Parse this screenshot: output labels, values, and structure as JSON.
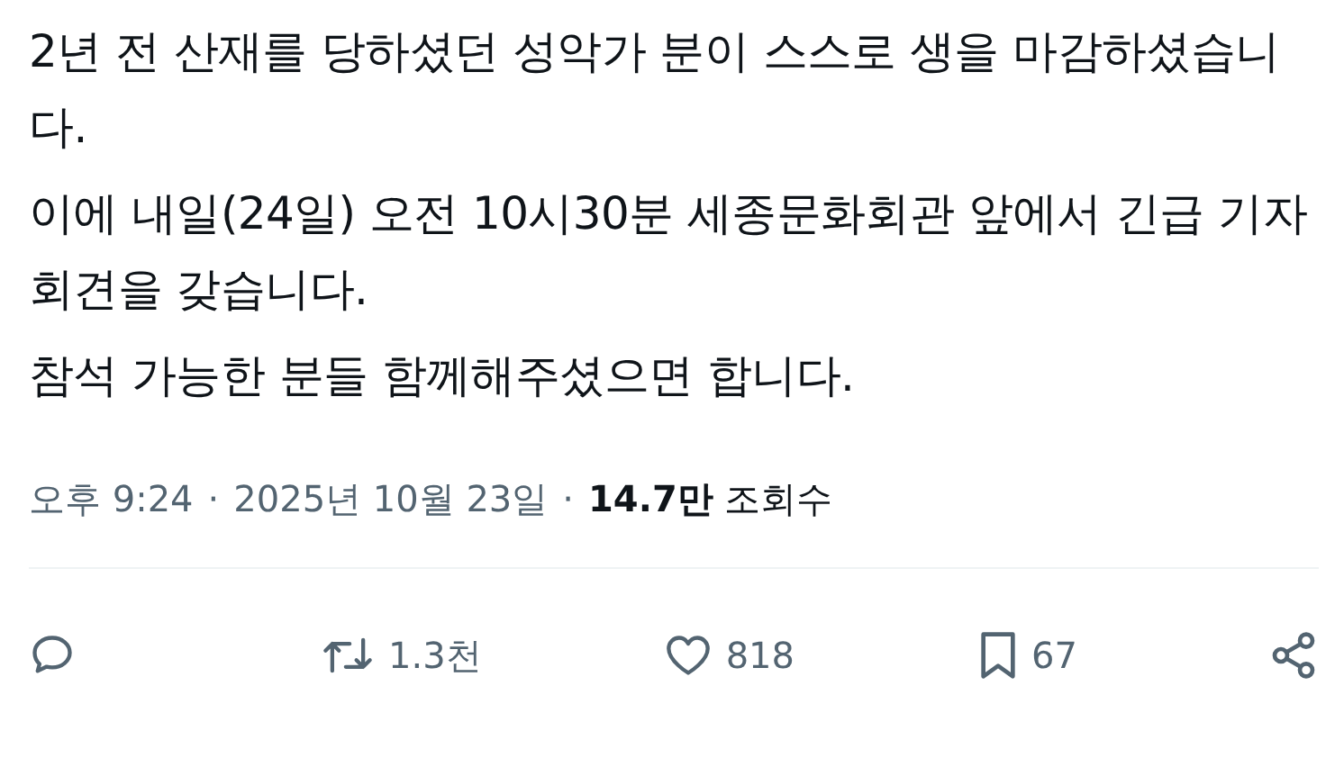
{
  "post": {
    "paragraphs": [
      "2년 전 산재를 당하셨던 성악가 분이 스스로 생을 마감하셨습니다.",
      "이에 내일(24일) 오전 10시30분 세종문화회관 앞에서 긴급 기자회견을 갖습니다.",
      "참석 가능한 분들 함께해주셨으면 합니다."
    ],
    "meta": {
      "time": "오후 9:24",
      "separator_1": "·",
      "date": "2025년 10월 23일",
      "separator_2": "·",
      "views_count": "14.7만",
      "views_label": "조회수"
    },
    "actions": [
      {
        "kind": "reply"
      },
      {
        "kind": "repost",
        "count": "1.3천"
      },
      {
        "kind": "like",
        "count": "818"
      },
      {
        "kind": "bookmark",
        "count": "67"
      },
      {
        "kind": "share"
      }
    ]
  }
}
